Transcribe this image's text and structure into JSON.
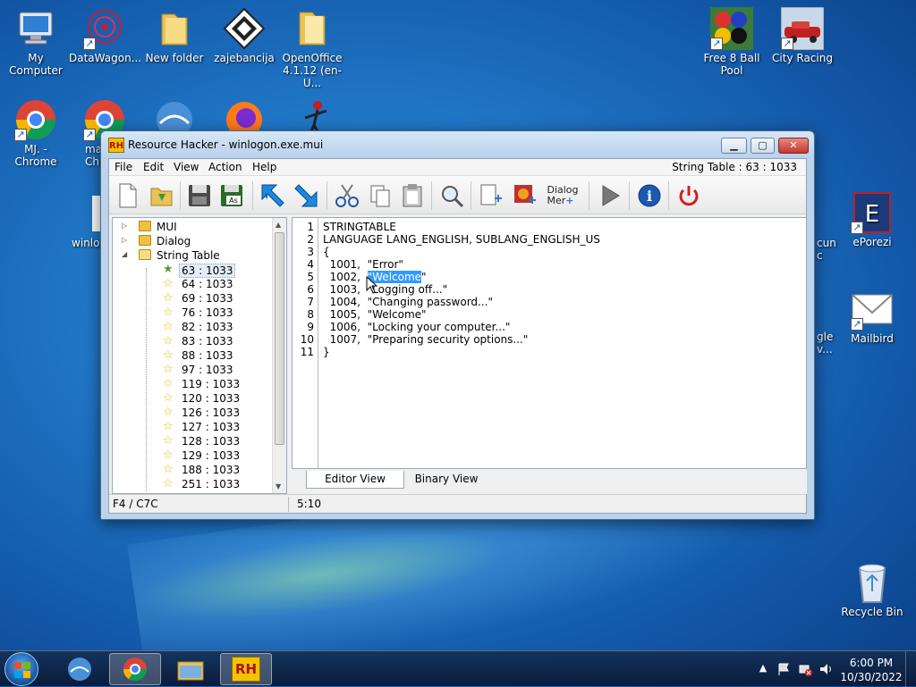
{
  "desktop": {
    "icons": {
      "my_computer": "My Computer",
      "datawagon": "DataWagon...",
      "new_folder": "New folder",
      "zajebancija": "zajebancija",
      "openoffice_1": "OpenOffice",
      "openoffice_2": "4.1.12 (en-U...",
      "free8ball_1": "Free 8 Ball",
      "free8ball_2": "Pool",
      "city_racing": "City Racing",
      "mj_chrome_1": "MJ. -",
      "mj_chrome_2": "Chrome",
      "chrome2_1": "ma",
      "chrome2_2": "Chi",
      "winlog": "winlog",
      "partial_right_1": "cun",
      "partial_right_2": "c",
      "eporezi": "ePorezi",
      "partial_right3_1": "gle",
      "partial_right3_2": "v...",
      "mailbird": "Mailbird",
      "recycle_bin": "Recycle Bin"
    }
  },
  "window": {
    "title": "Resource Hacker - winlogon.exe.mui",
    "logo": "RH",
    "menu": [
      "File",
      "Edit",
      "View",
      "Action",
      "Help"
    ],
    "header_info": "String Table : 63 : 1033",
    "toolbar": {
      "dialog_line1": "Dialog",
      "dialog_line2": "Mer"
    },
    "tree": {
      "folders": [
        "MUI",
        "Dialog",
        "String Table"
      ],
      "items": [
        "63 : 1033",
        "64 : 1033",
        "69 : 1033",
        "76 : 1033",
        "82 : 1033",
        "83 : 1033",
        "88 : 1033",
        "97 : 1033",
        "119 : 1033",
        "120 : 1033",
        "126 : 1033",
        "127 : 1033",
        "128 : 1033",
        "129 : 1033",
        "188 : 1033",
        "251 : 1033"
      ]
    },
    "editor": {
      "line_numbers": [
        "1",
        "2",
        "3",
        "4",
        "5",
        "6",
        "7",
        "8",
        "9",
        "10",
        "11"
      ],
      "lines": [
        "STRINGTABLE",
        "LANGUAGE LANG_ENGLISH, SUBLANG_ENGLISH_US",
        "{",
        "  1001,  \"Error\"",
        "  1002,  ",
        "  1003,  \"Logging off...\"",
        "  1004,  \"Changing password...\"",
        "  1005,  \"Welcome\"",
        "  1006,  \"Locking your computer...\"",
        "  1007,  \"Preparing security options...\"",
        "}"
      ],
      "selected_text": "\"Welcome",
      "after_selection": "\""
    },
    "tabs": [
      "Editor View",
      "Binary View"
    ],
    "status": {
      "left": "F4 / C7C",
      "right": "5:10"
    }
  },
  "taskbar": {
    "time": "6:00 PM",
    "date": "10/30/2022",
    "rh_label": "RH"
  }
}
